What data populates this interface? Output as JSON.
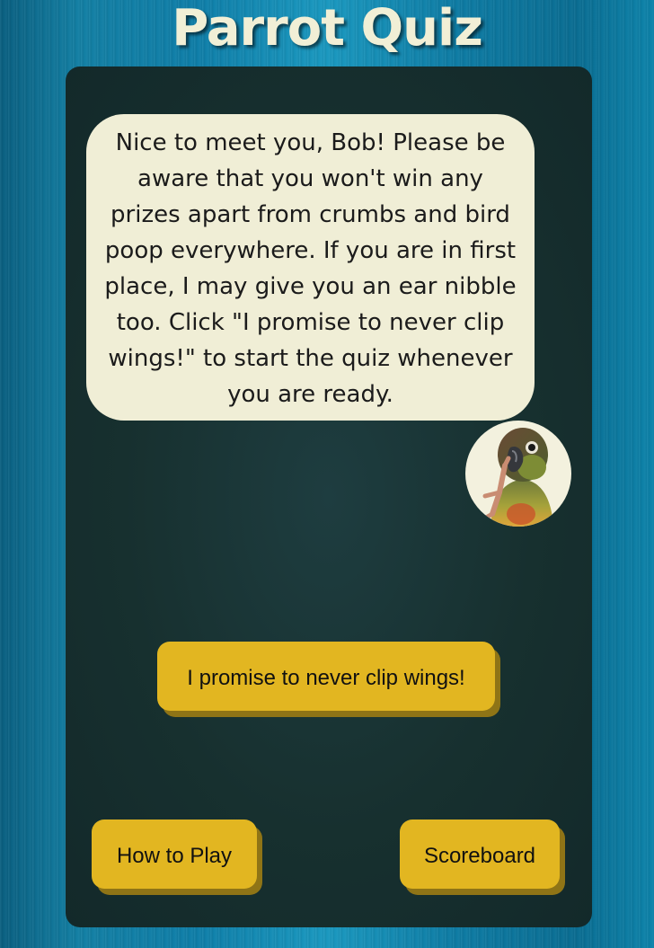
{
  "header": {
    "title": "Parrot Quiz"
  },
  "dialog": {
    "message": "Nice to meet you, Bob! Please be aware that you won't win any prizes apart from crumbs and bird poop everywhere. If you are in first place, I may give you an ear nibble too. Click \"I promise to never clip wings!\" to start the quiz whenever you are ready."
  },
  "avatar": {
    "icon": "parrot-icon"
  },
  "actions": {
    "start_label": "I promise to never clip wings!",
    "how_to_play_label": "How to Play",
    "scoreboard_label": "Scoreboard"
  },
  "colors": {
    "button": "#e2b621",
    "button_shadow": "#8f7416",
    "speech_bubble": "#f0eed6",
    "panel": "#17302f",
    "title_text": "#f1efd6"
  }
}
